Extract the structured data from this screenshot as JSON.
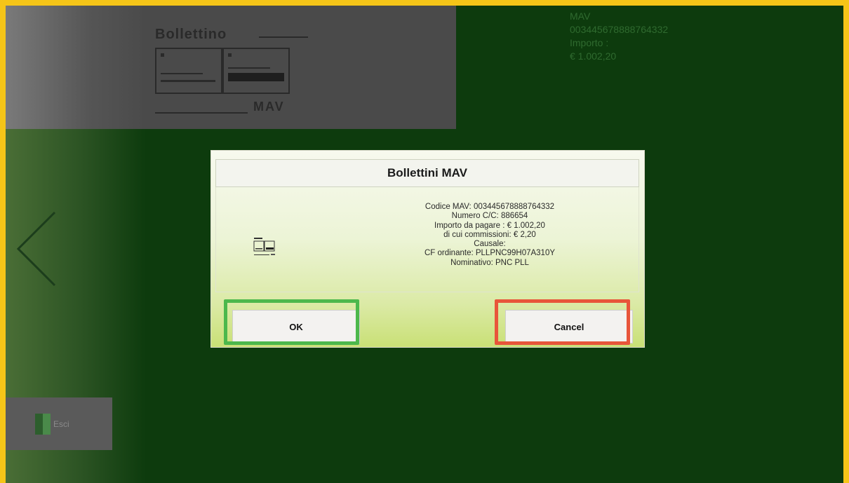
{
  "header": {
    "logo_title": "Bollettino",
    "logo_mav": "MAV",
    "info_label_mav": "MAV",
    "info_code": "003445678888764332",
    "info_label_amount": "Importo :",
    "info_amount": "€ 1.002,20"
  },
  "nav": {
    "back_icon": "chevron-left-icon"
  },
  "exit": {
    "label": "Esci",
    "icon": "exit-door-icon"
  },
  "status_bar": {
    "left": "",
    "center": "",
    "right": ""
  },
  "dialog": {
    "title": "Bollettini MAV",
    "thumb_icon": "mav-slip-icon",
    "lines": [
      "Codice MAV: 003445678888764332",
      "Numero C/C: 886654",
      "Importo da pagare :  € 1.002,20",
      "di cui commissioni: € 2,20",
      "Causale:",
      "CF ordinante: PLLPNC99H07A310Y",
      "Nominativo: PNC PLL"
    ],
    "ok_label": "OK",
    "cancel_label": "Cancel"
  },
  "colors": {
    "frame": "#f5c518",
    "background": "#0d3b0d",
    "ok_highlight": "#4cb84c",
    "cancel_highlight": "#e8553a"
  }
}
